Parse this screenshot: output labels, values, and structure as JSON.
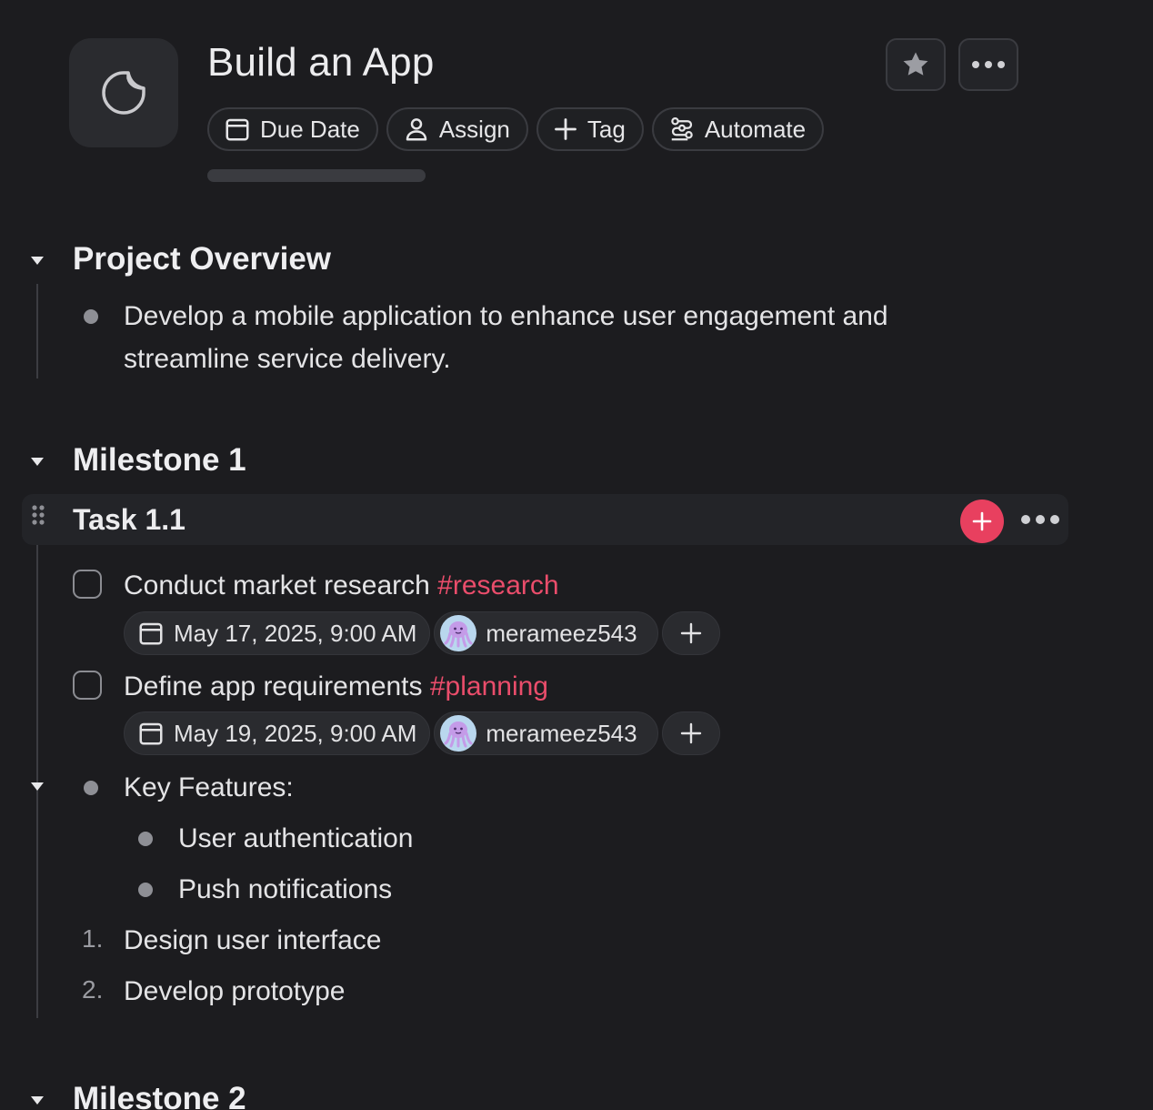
{
  "header": {
    "title": "Build an App",
    "icon": "page-icon",
    "progress": 0,
    "chips": [
      {
        "label": "Due Date",
        "icon": "calendar-icon"
      },
      {
        "label": "Assign",
        "icon": "person-icon"
      },
      {
        "label": "Tag",
        "icon": "plus-icon"
      },
      {
        "label": "Automate",
        "icon": "automate-icon"
      }
    ],
    "actions": [
      {
        "name": "favorite",
        "icon": "star-icon"
      },
      {
        "name": "more",
        "icon": "more-icon"
      }
    ]
  },
  "sections": {
    "overview": {
      "heading": "Project Overview",
      "bullet_line1": "Develop a mobile application to enhance user engagement and",
      "bullet_line2": "streamline service delivery."
    },
    "milestone1": {
      "heading": "Milestone 1",
      "task": {
        "title": "Task 1.1",
        "items": [
          {
            "text": "Conduct market research ",
            "tag": "#research",
            "date": "May 17, 2025, 9:00 AM",
            "assignee": "merameez543"
          },
          {
            "text": "Define app requirements ",
            "tag": "#planning",
            "date": "May 19, 2025, 9:00 AM",
            "assignee": "merameez543"
          }
        ]
      },
      "features": {
        "label": "Key Features:",
        "items": [
          "User authentication",
          "Push notifications"
        ]
      },
      "numbered": [
        {
          "num": "1.",
          "text": "Design user interface"
        },
        {
          "num": "2.",
          "text": "Develop prototype"
        }
      ]
    },
    "milestone2": {
      "heading": "Milestone 2"
    }
  },
  "colors": {
    "background": "#1c1c1f",
    "accent": "#e8405f",
    "tag": "#ea4d6b"
  }
}
